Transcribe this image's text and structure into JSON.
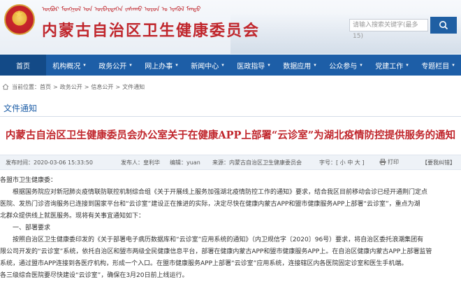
{
  "header": {
    "mongolian_text": "ᠥᠪᠥᠷ ᠮᠣᠩᠭᠣᠯ ᠤᠨ ᠥᠪᠡᠷᠲᠡᠭᠡᠨ ᠵᠠᠰᠠᠬᠤ ᠣᠷᠤᠨ ᠤ ᠡᠷᠡᠭᠦᠯ ᠮᠡᠨᠳᠦ",
    "site_title": "内蒙古自治区卫生健康委员会",
    "search_placeholder": "请输入搜索关键字(最多15)"
  },
  "nav": {
    "items": [
      {
        "label": "首页",
        "has_menu": false
      },
      {
        "label": "机构概况",
        "has_menu": true
      },
      {
        "label": "政务公开",
        "has_menu": true
      },
      {
        "label": "网上办事",
        "has_menu": true
      },
      {
        "label": "新闻中心",
        "has_menu": true
      },
      {
        "label": "医政指导",
        "has_menu": true
      },
      {
        "label": "数据应用",
        "has_menu": true
      },
      {
        "label": "公众参与",
        "has_menu": true
      },
      {
        "label": "党建工作",
        "has_menu": true
      },
      {
        "label": "专题栏目",
        "has_menu": true
      }
    ]
  },
  "breadcrumb": {
    "prefix": "当前位置：",
    "items": [
      "首页",
      "政务公开",
      "信息公开",
      "文件通知"
    ],
    "separator": ">"
  },
  "section": {
    "title": "文件通知"
  },
  "article": {
    "title": "内蒙古自治区卫生健康委员会办公室关于在健康APP上部署“云诊室”为湖北疫情防控提供服务的通知",
    "meta": {
      "time": "发布时间：2020-03-06 15:33:50",
      "author": "发布人：皇利华",
      "editor": "编辑：yuan",
      "source": "来源：内蒙古自治区卫生健康委员会",
      "font_size_prefix": "字号：[",
      "font_sizes": [
        "小",
        "中",
        "大"
      ],
      "font_size_suffix": "]",
      "print": "打印",
      "correction": "【要我纠错】"
    },
    "paragraphs": [
      {
        "text": "各盟市卫生健康委：",
        "indent": false
      },
      {
        "text": "根据国务院应对新冠肺炎疫情联防联控机制综合组《关于开展线上服务加强湖北疫情防控工作的通知》要求，结合我区目前移动会诊已经开通荆门定点",
        "indent": true
      },
      {
        "text": "医院、发热门诊咨询服务已连接到国家平台和“云诊室”建设正在推进的实际，决定尽快在健康内蒙古APP和盟市健康服务APP上部署“云诊室”，重点为湖",
        "indent": false
      },
      {
        "text": "北群众提供线上就医服务。现将有关事宜通知如下：",
        "indent": false
      },
      {
        "text": "一、部署要求",
        "indent": true
      },
      {
        "text": "按照自治区卫生健康委印发的《关于部署电子病历数据库和“云诊室”应用系统的通知》（内卫规信字〔2020〕96号）要求，将自治区委托浪潮集团有",
        "indent": true
      },
      {
        "text": "限公司开发的“云诊室”系统，依托自治区和盟市两级全民健康信息平台，部署在健康内蒙古APP和盟市健康服务APP上。在自治区健康内蒙古APP上部署监管",
        "indent": false
      },
      {
        "text": "系统，通过盟市APP连接到各医疗机构，形成一个入口。在盟市健康服务APP上部署“云诊室”应用系统，连接辖区内各医院固定诊室和医生手机端。",
        "indent": false
      },
      {
        "text": "各三级综合医院要尽快建设“云诊室”，确保在3月20日前上线运行。",
        "indent": false
      }
    ]
  },
  "colors": {
    "brand_red": "#c0262c",
    "nav_blue": "#1d5ea7",
    "meta_bg": "#eef2f7"
  }
}
